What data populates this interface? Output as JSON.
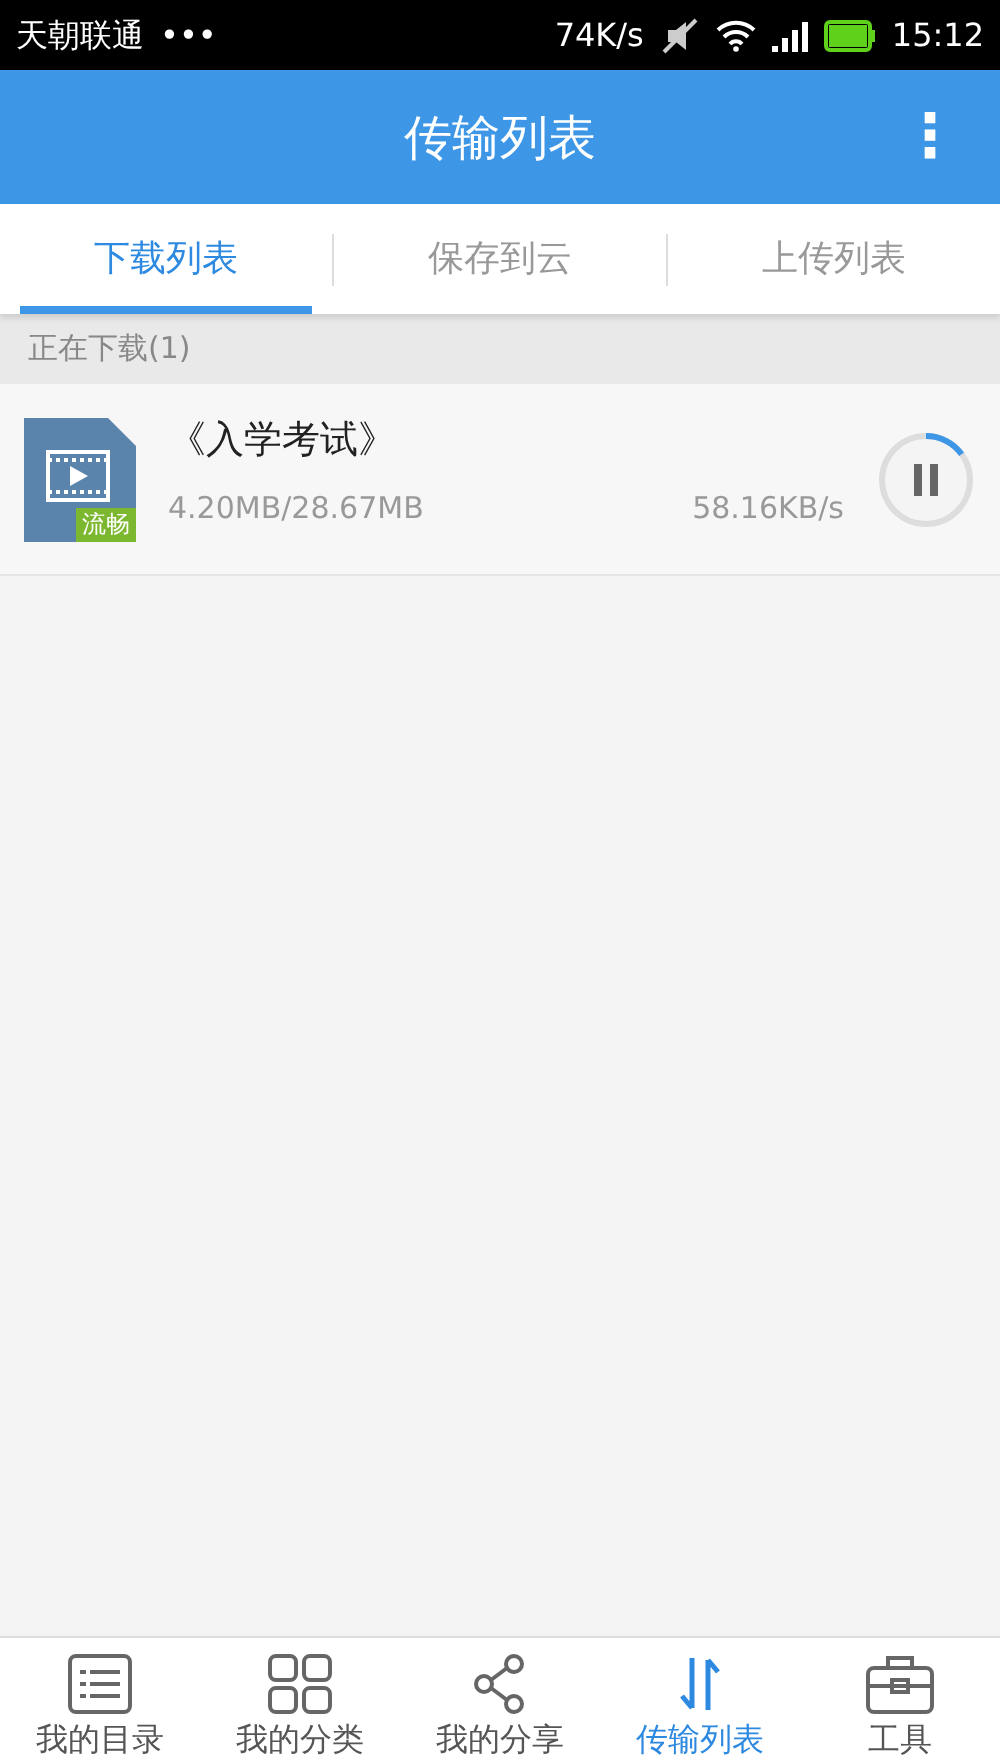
{
  "status_bar": {
    "carrier": "天朝联通",
    "dots": "•••",
    "speed": "74K/s",
    "time": "15:12"
  },
  "header": {
    "title": "传输列表",
    "menu": "⋮"
  },
  "tabs": [
    {
      "label": "下载列表",
      "selected": true
    },
    {
      "label": "保存到云",
      "selected": false
    },
    {
      "label": "上传列表",
      "selected": false
    }
  ],
  "section": {
    "title": "正在下载(1)"
  },
  "downloads": [
    {
      "name": "《入学考试》",
      "badge": "流畅",
      "size": "4.20MB/28.67MB",
      "speed": "58.16KB/s",
      "level": 0.15,
      "paused": false
    }
  ],
  "bottom_nav": [
    {
      "label": "我的目录",
      "selected": false
    },
    {
      "label": "我的分类",
      "selected": false
    },
    {
      "label": "我的分享",
      "selected": false
    },
    {
      "label": "传输列表",
      "selected": true
    },
    {
      "label": "工具",
      "selected": false
    }
  ]
}
